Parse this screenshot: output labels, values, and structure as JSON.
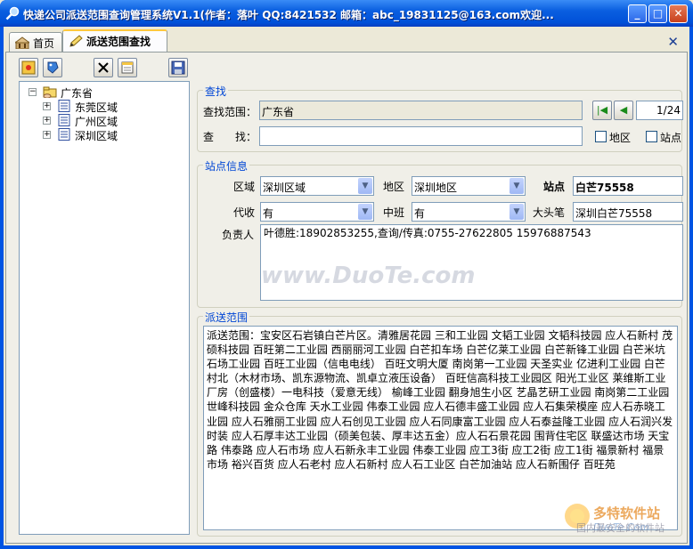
{
  "window": {
    "title": "快递公司派送范围查询管理系统V1.1(作者：落叶  QQ:8421532 邮箱：abc_19831125@163.com欢迎...",
    "controls": {
      "minimize": "_",
      "maximize": "□",
      "close": "✕"
    }
  },
  "tabs": [
    {
      "label": "首页",
      "icon": "home-icon",
      "active": false
    },
    {
      "label": "派送范围查找",
      "icon": "pencil-icon",
      "active": true
    }
  ],
  "tab_close": "✕",
  "toolbar": [
    "locate-icon",
    "tag-icon",
    "delete-icon",
    "edit-icon",
    "save-icon"
  ],
  "tree": {
    "root": {
      "label": "广东省",
      "expander": "−",
      "icon": "hand-folder-icon"
    },
    "children": [
      {
        "label": "东莞区域",
        "expander": "+"
      },
      {
        "label": "广州区域",
        "expander": "+"
      },
      {
        "label": "深圳区域",
        "expander": "+"
      }
    ]
  },
  "search": {
    "title": "查找",
    "scope_label": "查找范围：",
    "scope_value": "广东省",
    "find_label": "查　　找：",
    "find_value": "",
    "page_indicator": "1/24",
    "first_btn": "|◀",
    "prev_btn": "◀",
    "check_area": "地区",
    "check_station": "站点"
  },
  "station": {
    "title": "站点信息",
    "region_label": "区域",
    "region_value": "深圳区域",
    "area_label": "地区",
    "area_value": "深圳地区",
    "station_label": "站点",
    "station_value": "白芒75558",
    "cod_label": "代收",
    "cod_value": "有",
    "shift_label": "中班",
    "shift_value": "有",
    "head_label": "大头笔",
    "head_value": "深圳白芒75558",
    "manager_label": "负责人",
    "manager_value": "叶德胜:18902853255,查询/传真:0755-27622805  15976887543"
  },
  "delivery": {
    "title": "派送范围",
    "text": "派送范围：宝安区石岩镇白芒片区。清雅居花园 三和工业园 文韬工业园 文韬科技园 应人石新村 茂硕科技园 百旺第二工业园 西丽丽河工业园  白芒扣车场  白芒亿莱工业园 白芒新锋工业园  白芒米坑石场工业园 百旺工业园（信电电线）  百旺文明大厦  南岗第一工业园 天圣实业  亿进利工业园 白芒村北（木材市场、凯东源物流、凯卓立液压设备） 百旺信高科技工业园区  阳光工业区  莱维斯工业厂房（创盛楼）一电科技（爱意无线） 榆峰工业园 翻身旭生小区 艺晶艺研工业园  南岗第二工业园  世峰科技园 金众仓库 天水工业园 伟泰工业园  应人石德丰盛工业园  应人石集荣模座  应人石赤晓工业园 应人石雅丽工业园  应人石创见工业园 应人石同康富工业园 应人石泰益隆工业园  应人石润兴发时装 应人石厚丰达工业园（硕美包装、厚丰达五金）应人石石景花园   围背住宅区  联盛达市场  天宝路  伟泰路  应人石市场  应人石新永丰工业园  伟泰工业园 应工3街  应工2街 应工1街 福景新村  福景市场  裕兴百货  应人石老村  应人石新村  应人石工业区  白芒加油站  应人石新围仔 百旺苑"
  },
  "watermarks": {
    "main": "www.DuoTe.com",
    "logo": "多特软件站",
    "logo_sub": "DuoTe.Com",
    "logo_tag": "国内最安全的软件站"
  }
}
